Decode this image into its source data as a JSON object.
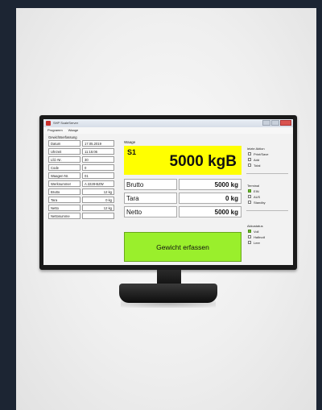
{
  "window": {
    "title": "SHP ScaleServer"
  },
  "menu": [
    "Programm",
    "Waage"
  ],
  "left_group": {
    "title": "Gewichtserfassung",
    "rows": [
      {
        "label": "Datum",
        "value": "17.05.2019"
      },
      {
        "label": "Uhrzeit",
        "value": "11:15:06"
      },
      {
        "label": "Lfd.-Nr.",
        "value": "30"
      },
      {
        "label": "Code",
        "value": "0"
      },
      {
        "label": "Waagen-Nr.",
        "value": "01"
      },
      {
        "label": "Werknummer",
        "value": "A 2228-BZW"
      },
      {
        "label": "Brutto",
        "value": "12 kg"
      },
      {
        "label": "Tara",
        "value": "0 kg"
      },
      {
        "label": "Netto",
        "value": "12 kg"
      },
      {
        "label": "Nettosumme",
        "value": ""
      }
    ]
  },
  "main": {
    "waage_label": "Waage",
    "scale_name": "S1",
    "big_weight": "5000 kgB",
    "rows": [
      {
        "label": "Brutto",
        "value": "5000 kg"
      },
      {
        "label": "Tara",
        "value": "0 kg"
      },
      {
        "label": "Netto",
        "value": "5000 kg"
      }
    ],
    "capture_button": "Gewicht erfassen"
  },
  "right_panel": {
    "last_action": {
      "title": "letzte Aktion",
      "items": [
        {
          "label": "Print/Save",
          "checked": false
        },
        {
          "label": "Add",
          "checked": false
        },
        {
          "label": "Total",
          "checked": false
        }
      ]
    },
    "terminal": {
      "title": "Terminal",
      "items": [
        {
          "label": "EIN",
          "checked": true
        },
        {
          "label": "AUS",
          "checked": false
        },
        {
          "label": "Standby",
          "checked": false
        }
      ]
    },
    "battery": {
      "title": "Akkustatus",
      "items": [
        {
          "label": "Voll",
          "checked": true
        },
        {
          "label": "Halbvoll",
          "checked": false
        },
        {
          "label": "Leer",
          "checked": false
        }
      ]
    }
  },
  "colors": {
    "display_yellow": "#ffff00",
    "capture_green": "#9aef2c",
    "status_on_green": "#6cbf2a"
  }
}
